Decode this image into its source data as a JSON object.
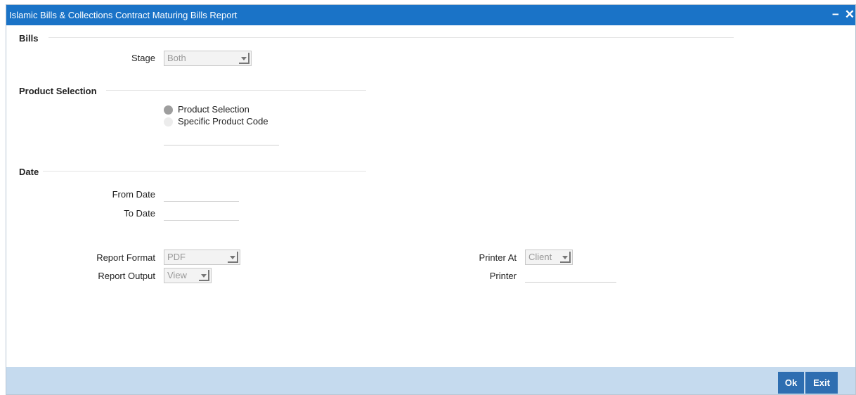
{
  "window": {
    "title": "Islamic Bills & Collections Contract Maturing Bills Report",
    "minimize_label": "−",
    "close_label": "✕"
  },
  "bills": {
    "section_title": "Bills",
    "stage_label": "Stage",
    "stage_value": "Both"
  },
  "product_selection": {
    "section_title": "Product Selection",
    "options": [
      {
        "label": "Product Selection",
        "selected": true
      },
      {
        "label": "Specific Product Code",
        "selected": false
      }
    ],
    "product_code_value": ""
  },
  "date": {
    "section_title": "Date",
    "from_label": "From Date",
    "from_value": "",
    "to_label": "To Date",
    "to_value": ""
  },
  "report": {
    "format_label": "Report Format",
    "format_value": "PDF",
    "output_label": "Report Output",
    "output_value": "View",
    "printer_at_label": "Printer At",
    "printer_at_value": "Client",
    "printer_label": "Printer",
    "printer_value": ""
  },
  "footer": {
    "ok_label": "Ok",
    "exit_label": "Exit"
  },
  "colors": {
    "titlebar": "#1a73c7",
    "footer": "#c5daee",
    "button": "#2e6eb1"
  }
}
